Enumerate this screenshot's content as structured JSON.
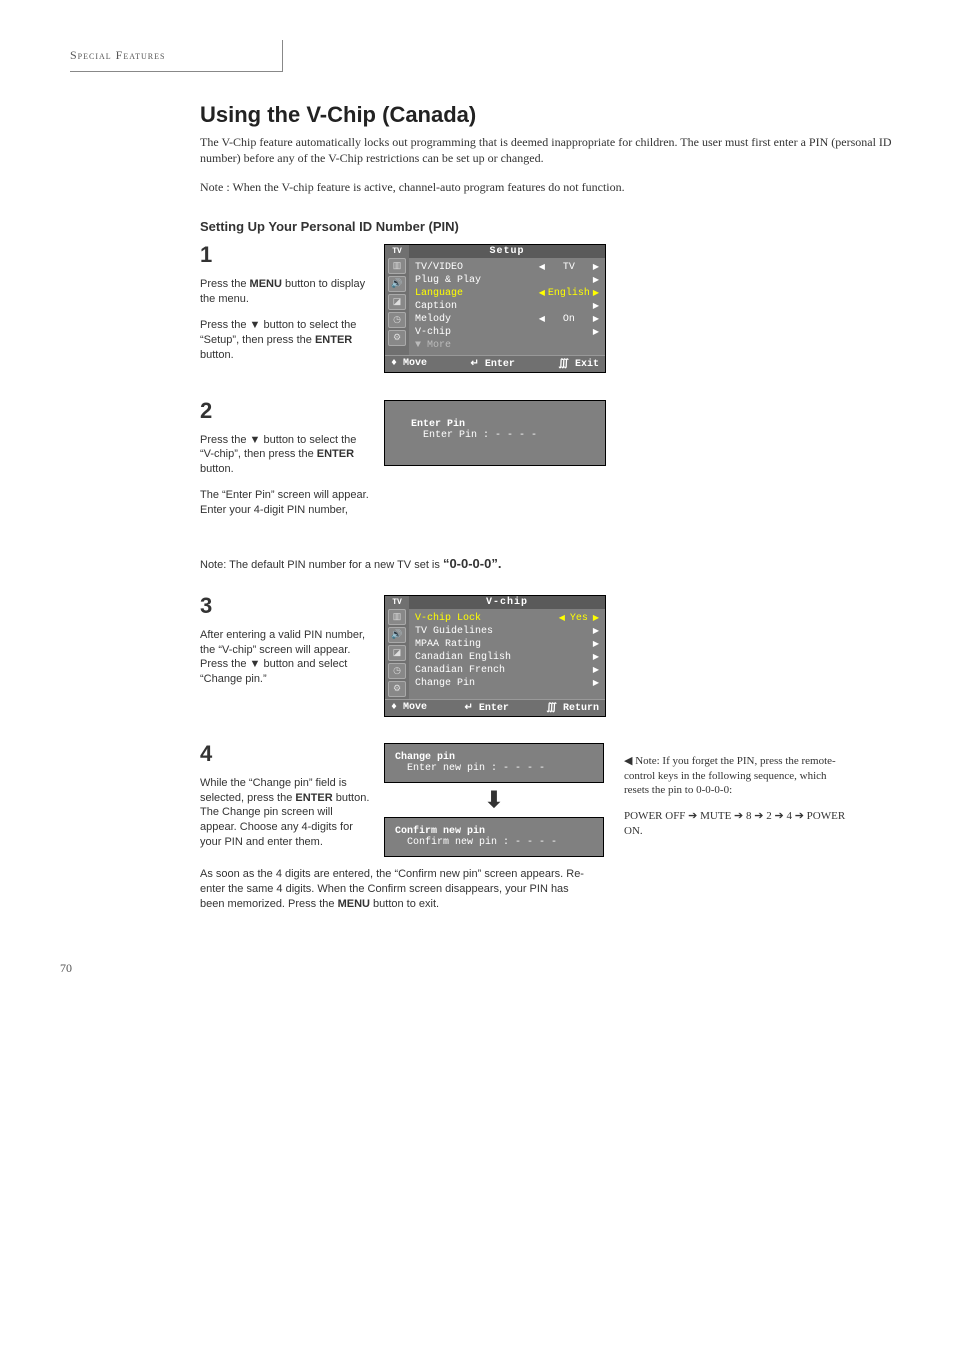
{
  "running_head": "Special Features",
  "title": "Using the V-Chip (Canada)",
  "intro": "The V-Chip feature automatically locks out programming that is deemed inappropriate for children. The user must first enter a PIN (personal ID number) before any of the V-Chip restrictions can be set up or changed.",
  "note_top": "Note : When the V-chip feature is active, channel-auto program features do not function.",
  "subhead": "Setting Up Your Personal ID Number (PIN)",
  "step1": {
    "n": "1",
    "p1a": "Press the ",
    "p1b": "MENU",
    "p1c": " button to display the menu.",
    "p2a": "Press the ▼ button to select the “Setup”, then press the ",
    "p2b": "ENTER",
    "p2c": " button."
  },
  "osd1": {
    "tab": "TV",
    "title": "Setup",
    "rows": [
      {
        "label": "TV/VIDEO",
        "val": "TV",
        "left": "◀",
        "right": "▶"
      },
      {
        "label": "Plug & Play",
        "val": "",
        "left": "",
        "right": "▶"
      },
      {
        "label": "Language",
        "val": "English",
        "left": "◀",
        "right": "▶"
      },
      {
        "label": "Caption",
        "val": "",
        "left": "",
        "right": "▶"
      },
      {
        "label": "Melody",
        "val": "On",
        "left": "◀",
        "right": "▶"
      },
      {
        "label": "V-chip",
        "val": "",
        "left": "",
        "right": "▶"
      },
      {
        "label": "▼ More",
        "val": "",
        "left": "",
        "right": "",
        "dim": true
      }
    ],
    "footer": {
      "move": "♦ Move",
      "enter": "↵ Enter",
      "exit": "∭ Exit"
    }
  },
  "step2": {
    "n": "2",
    "p1a": "Press the ▼ button to select  the “V-chip”, then press the ",
    "p1b": "ENTER",
    "p1c": " button.",
    "p2": "The “Enter Pin” screen will appear. Enter your 4-digit PIN number,",
    "postnote_a": "Note: The default PIN number for a new TV set is ",
    "postnote_b": "“0-0-0-0”."
  },
  "osd2": {
    "l1": "Enter Pin",
    "l2": "Enter Pin   : - - - -"
  },
  "step3": {
    "n": "3",
    "p": "After entering a valid PIN number, the “V-chip” screen will appear. Press the ▼ button and select “Change pin.”"
  },
  "osd3": {
    "tab": "TV",
    "title": "V-chip",
    "rows": [
      {
        "label": "V-chip Lock",
        "val": "Yes",
        "left": "◀",
        "right": "▶"
      },
      {
        "label": "TV Guidelines",
        "val": "",
        "left": "",
        "right": "▶"
      },
      {
        "label": "MPAA Rating",
        "val": "",
        "left": "",
        "right": "▶"
      },
      {
        "label": "Canadian English",
        "val": "",
        "left": "",
        "right": "▶"
      },
      {
        "label": "Canadian French",
        "val": "",
        "left": "",
        "right": "▶"
      },
      {
        "label": "Change Pin",
        "val": "",
        "left": "",
        "right": "▶"
      }
    ],
    "footer": {
      "move": "♦ Move",
      "enter": "↵ Enter",
      "exit": "∭ Return"
    }
  },
  "step4": {
    "n": "4",
    "p1a": "While the “Change pin” field is selected, press the ",
    "p1b": "ENTER",
    "p1c": " button",
    "p1d": ". The Change pin screen will appear. Choose any 4-digits for your PIN and enter them.",
    "post_a": "As soon as the 4 digits are entered, the “Confirm new pin” screen appears. Re-enter the same 4 digits. When the Confirm screen disappears, your PIN has been memorized. Press the ",
    "post_b": "MENU",
    "post_c": " button to exit."
  },
  "osd4a": {
    "l1": "Change pin",
    "l2": "Enter new pin : - - - -"
  },
  "osd4b": {
    "l1": "Confirm new pin",
    "l2": "Confirm new pin : - - - -"
  },
  "sidenote": {
    "l1a": "◀ ",
    "l1b": "Note: If you forget the PIN, press the remote-control keys in the following sequence, which resets the pin to 0-0-0-0:",
    "l2": "POWER OFF ➔ MUTE ➔ 8 ➔ 2 ➔ 4 ➔ POWER ON."
  },
  "page": "70"
}
